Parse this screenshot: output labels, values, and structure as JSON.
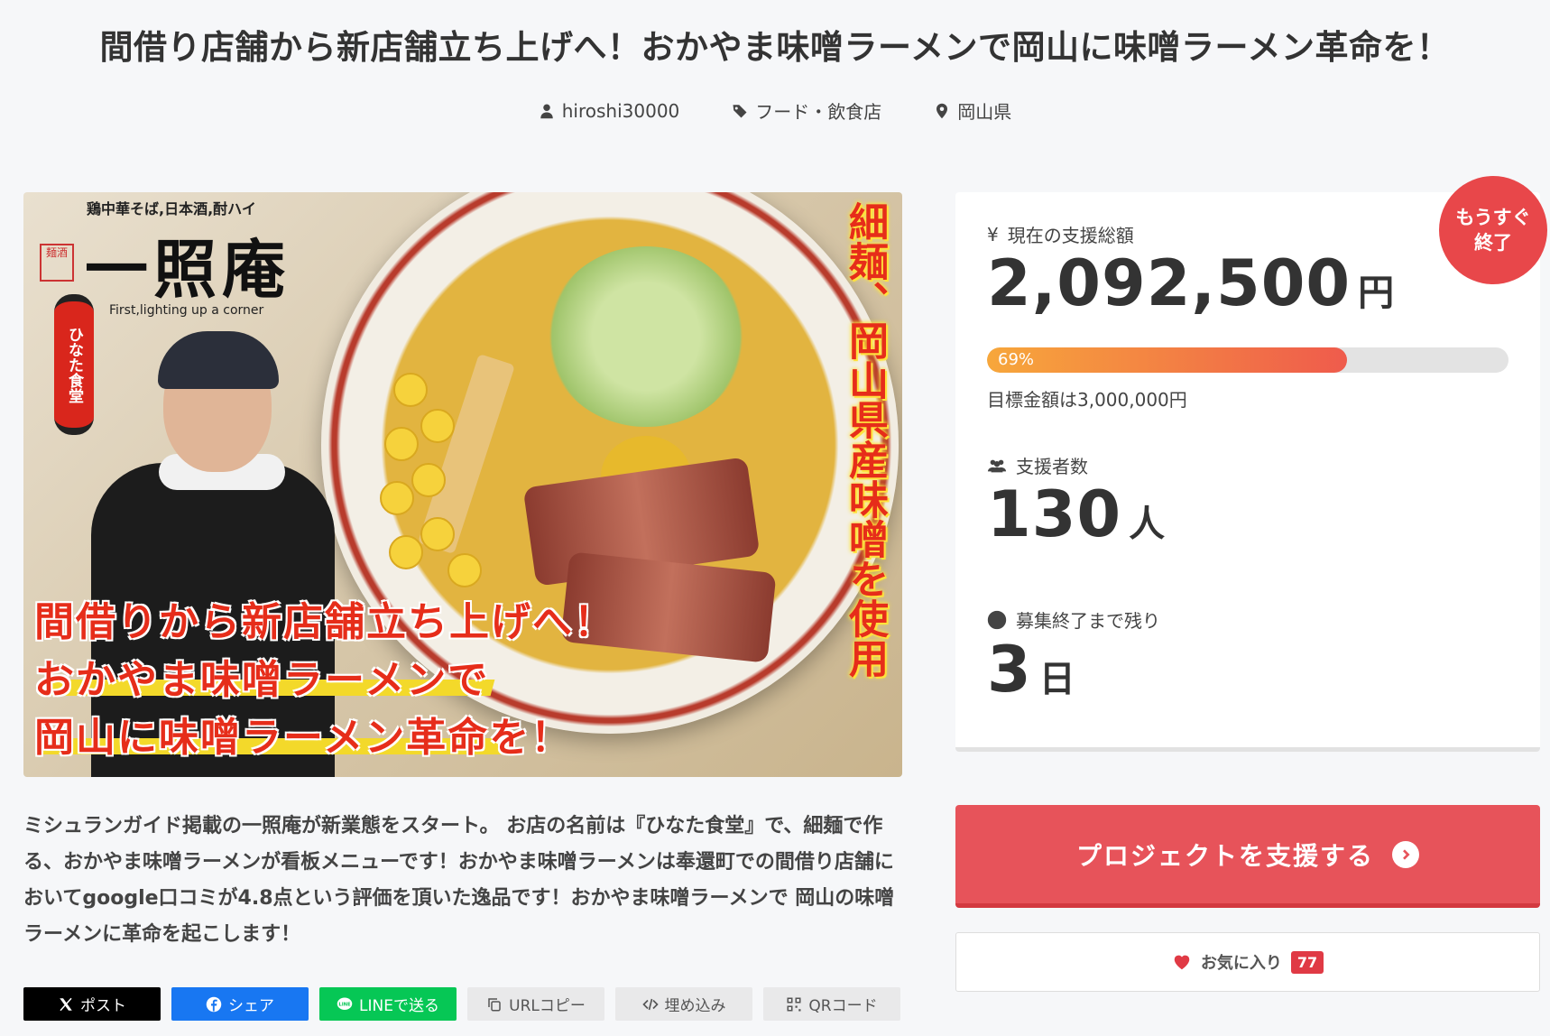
{
  "project": {
    "title": "間借り店舗から新店舗立ち上げへ！おかやま味噌ラーメンで岡山に味噌ラーメン革命を！",
    "owner": "hiroshi30000",
    "category": "フード・飲食店",
    "location": "岡山県"
  },
  "hero": {
    "logo_top": "鶏中華そば,日本酒,酎ハイ",
    "logo_main": "一照庵",
    "logo_sub": "First,lighting up a corner",
    "seal": "麺酒",
    "lantern": "ひなた食堂",
    "vertical_text": "細麺、岡山県産味噌を使用",
    "caption_line1": "間借りから新店舗立ち上げへ！",
    "caption_line2": "おかやま味噌ラーメンで",
    "caption_line3": "岡山に味噌ラーメン革命を！"
  },
  "description": "ミシュランガイド掲載の一照庵が新業態をスタート。 お店の名前は『ひなた食堂』で、細麺で作る、おかやま味噌ラーメンが看板メニューです！おかやま味噌ラーメンは奉還町での間借り店舗においてgoogle口コミが4.8点という評価を頂いた逸品です！おかやま味噌ラーメンで 岡山の味噌ラーメンに革命を起こします！",
  "share": {
    "x": "ポスト",
    "facebook": "シェア",
    "line": "LINEで送る",
    "url_copy": "URLコピー",
    "embed": "埋め込み",
    "qr": "QRコード"
  },
  "stats": {
    "badge_line1": "もうすぐ",
    "badge_line2": "終了",
    "amount_label": "現在の支援総額",
    "amount": "2,092,500",
    "amount_unit": "円",
    "progress_label": "69%",
    "progress_fraction": 0.69,
    "goal_text": "目標金額は3,000,000円",
    "supporters_label": "支援者数",
    "supporters": "130",
    "supporters_unit": "人",
    "remaining_label": "募集終了まで残り",
    "remaining": "3",
    "remaining_unit": "日"
  },
  "actions": {
    "support_label": "プロジェクトを支援する",
    "favorite_label": "お気に入り",
    "favorite_count": "77"
  },
  "colors": {
    "accent": "#e7535a",
    "badge": "#e8474a",
    "progress_start": "#f7a73b",
    "progress_end": "#ef5b4c"
  }
}
